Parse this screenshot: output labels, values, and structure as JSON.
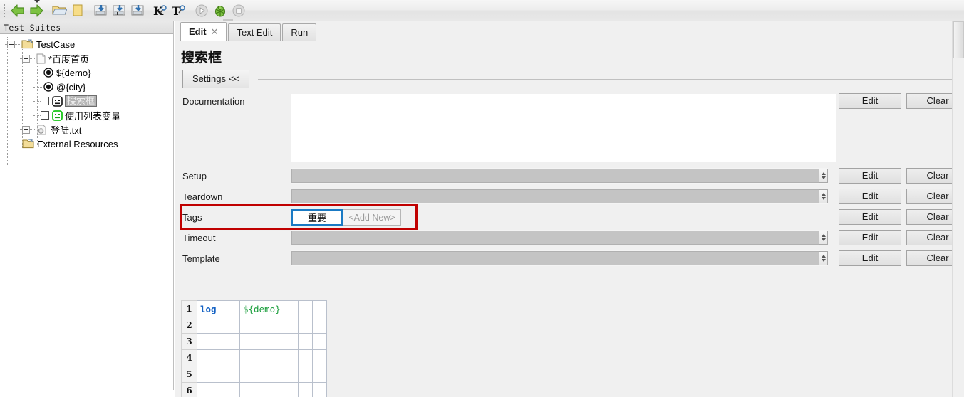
{
  "toolbar": {
    "items": [
      {
        "name": "back-icon",
        "title": "Back"
      },
      {
        "name": "forward-icon",
        "title": "Forward"
      },
      {
        "name": "open-folder-icon",
        "title": "Open Directory"
      },
      {
        "name": "new-file-icon",
        "title": "New Project"
      },
      {
        "name": "save-icon",
        "title": "Save"
      },
      {
        "name": "save-as-icon",
        "title": "Save As"
      },
      {
        "name": "save-all-icon",
        "title": "Save All"
      },
      {
        "name": "search-keyword-icon",
        "title": "K",
        "letter": "K"
      },
      {
        "name": "search-tests-icon",
        "title": "T",
        "letter": "T"
      },
      {
        "name": "run-icon",
        "title": "Run"
      },
      {
        "name": "debug-icon",
        "title": "Debug"
      },
      {
        "name": "stop-icon",
        "title": "Stop"
      }
    ]
  },
  "sidebar": {
    "header": "Test Suites",
    "tree": [
      {
        "label": "TestCase",
        "icon": "test-suite-icon",
        "expander": "minus",
        "depth": 0,
        "selected": false,
        "checkbox": false
      },
      {
        "label": "*百度首页",
        "icon": "test-suite-file-icon",
        "expander": "minus",
        "depth": 1,
        "selected": false,
        "checkbox": false
      },
      {
        "label": "${demo}",
        "icon": "scalar-variable-icon",
        "expander": "none",
        "depth": 2,
        "selected": false,
        "checkbox": false
      },
      {
        "label": "@{city}",
        "icon": "list-variable-icon",
        "expander": "none",
        "depth": 2,
        "selected": false,
        "checkbox": false
      },
      {
        "label": "搜索框",
        "icon": "test-case-icon",
        "expander": "none",
        "depth": 2,
        "selected": true,
        "checkbox": true
      },
      {
        "label": "使用列表变量",
        "icon": "test-case-icon-green",
        "expander": "none",
        "depth": 2,
        "selected": false,
        "checkbox": true
      },
      {
        "label": "登陆.txt",
        "icon": "resource-file-icon",
        "expander": "plus",
        "depth": 1,
        "selected": false,
        "checkbox": false
      },
      {
        "label": "External Resources",
        "icon": "external-resources-icon",
        "expander": "none",
        "depth": 0,
        "selected": false,
        "checkbox": false
      }
    ]
  },
  "tabs": [
    {
      "label": "Edit",
      "active": true,
      "closable": true,
      "close_glyph": "✕"
    },
    {
      "label": "Text Edit",
      "active": false,
      "closable": false
    },
    {
      "label": "Run",
      "active": false,
      "closable": false
    }
  ],
  "editor": {
    "title": "搜索框",
    "settings_toggle_label": "Settings <<",
    "rows": [
      {
        "label": "Documentation",
        "type": "textarea",
        "value": "",
        "edit_label": "Edit",
        "clear_label": "Clear",
        "spinner": false
      },
      {
        "label": "Setup",
        "type": "field",
        "value": "",
        "edit_label": "Edit",
        "clear_label": "Clear",
        "spinner": true
      },
      {
        "label": "Teardown",
        "type": "field",
        "value": "",
        "edit_label": "Edit",
        "clear_label": "Clear",
        "spinner": true
      },
      {
        "label": "Tags",
        "type": "tags",
        "edit_label": "Edit",
        "clear_label": "Clear",
        "spinner": false
      },
      {
        "label": "Timeout",
        "type": "field",
        "value": "",
        "edit_label": "Edit",
        "clear_label": "Clear",
        "spinner": true
      },
      {
        "label": "Template",
        "type": "field",
        "value": "",
        "edit_label": "Edit",
        "clear_label": "Clear",
        "spinner": true
      }
    ],
    "tags": {
      "chip_label": "重要",
      "add_new_label": "<Add New>",
      "highlight_color": "#c00000",
      "chip_border_color": "#1a7ac4"
    },
    "grid": {
      "row_numbers": [
        "1",
        "2",
        "3",
        "4",
        "5",
        "6"
      ],
      "rows": [
        [
          "log",
          "${demo}",
          "",
          "",
          ""
        ],
        [
          "",
          "",
          "",
          "",
          ""
        ],
        [
          "",
          "",
          "",
          "",
          ""
        ],
        [
          "",
          "",
          "",
          "",
          ""
        ],
        [
          "",
          "",
          "",
          "",
          ""
        ],
        [
          "",
          "",
          "",
          "",
          ""
        ]
      ],
      "keyword_color": "#1462c4",
      "variable_color": "#1a9e3c"
    }
  }
}
